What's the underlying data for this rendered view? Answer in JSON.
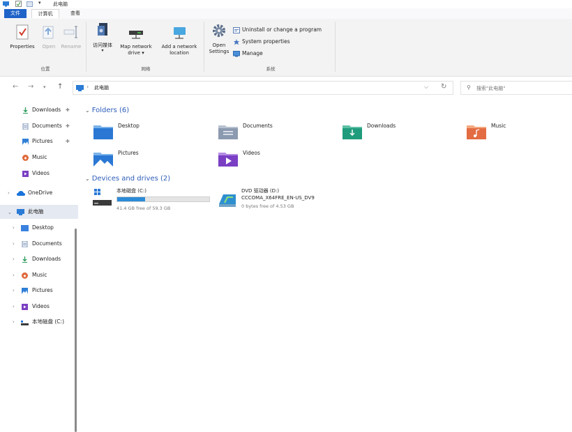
{
  "window": {
    "title": "此电脑"
  },
  "tabs": {
    "file": "文件",
    "computer": "计算机",
    "view": "查看"
  },
  "ribbon": {
    "location": {
      "label": "位置",
      "properties": "Properties",
      "open": "Open",
      "rename": "Rename"
    },
    "network": {
      "label": "网络",
      "access_media_l1": "访问媒体",
      "map_drive_l1": "Map network",
      "map_drive_l2": "drive ▾",
      "add_location_l1": "Add a network",
      "add_location_l2": "location"
    },
    "system": {
      "label": "系统",
      "open_settings_l1": "Open",
      "open_settings_l2": "Settings",
      "uninstall": "Uninstall or change a program",
      "system_properties": "System properties",
      "manage": "Manage"
    }
  },
  "address": {
    "crumb_sep": "›",
    "path": "此电脑",
    "search_placeholder": "搜索\"此电脑\""
  },
  "sidebar": {
    "quick": [
      {
        "label": "Downloads",
        "pinned": true
      },
      {
        "label": "Documents",
        "pinned": true
      },
      {
        "label": "Pictures",
        "pinned": true
      },
      {
        "label": "Music",
        "pinned": false
      },
      {
        "label": "Videos",
        "pinned": false
      }
    ],
    "onedrive": "OneDrive",
    "thispc": "此电脑",
    "pc_children": [
      "Desktop",
      "Documents",
      "Downloads",
      "Music",
      "Pictures",
      "Videos",
      "本地磁盘 (C:)"
    ]
  },
  "content": {
    "folders_header": "Folders (6)",
    "folders": [
      "Desktop",
      "Documents",
      "Downloads",
      "Music",
      "Pictures",
      "Videos"
    ],
    "drives_header": "Devices and drives (2)",
    "drive_c": {
      "name": "本地磁盘 (C:)",
      "free": "41.4 GB free of 59.3 GB",
      "used_fraction": 0.302
    },
    "drive_d": {
      "name": "DVD 驱动器 (D:)",
      "label": "CCCOMA_X64FRE_EN-US_DV9",
      "free": "0 bytes free of 4.53 GB"
    }
  },
  "colors": {
    "accent": "#1f63c8",
    "storage_bar": "#2b8bd8",
    "section_header": "#2c5cb8"
  }
}
